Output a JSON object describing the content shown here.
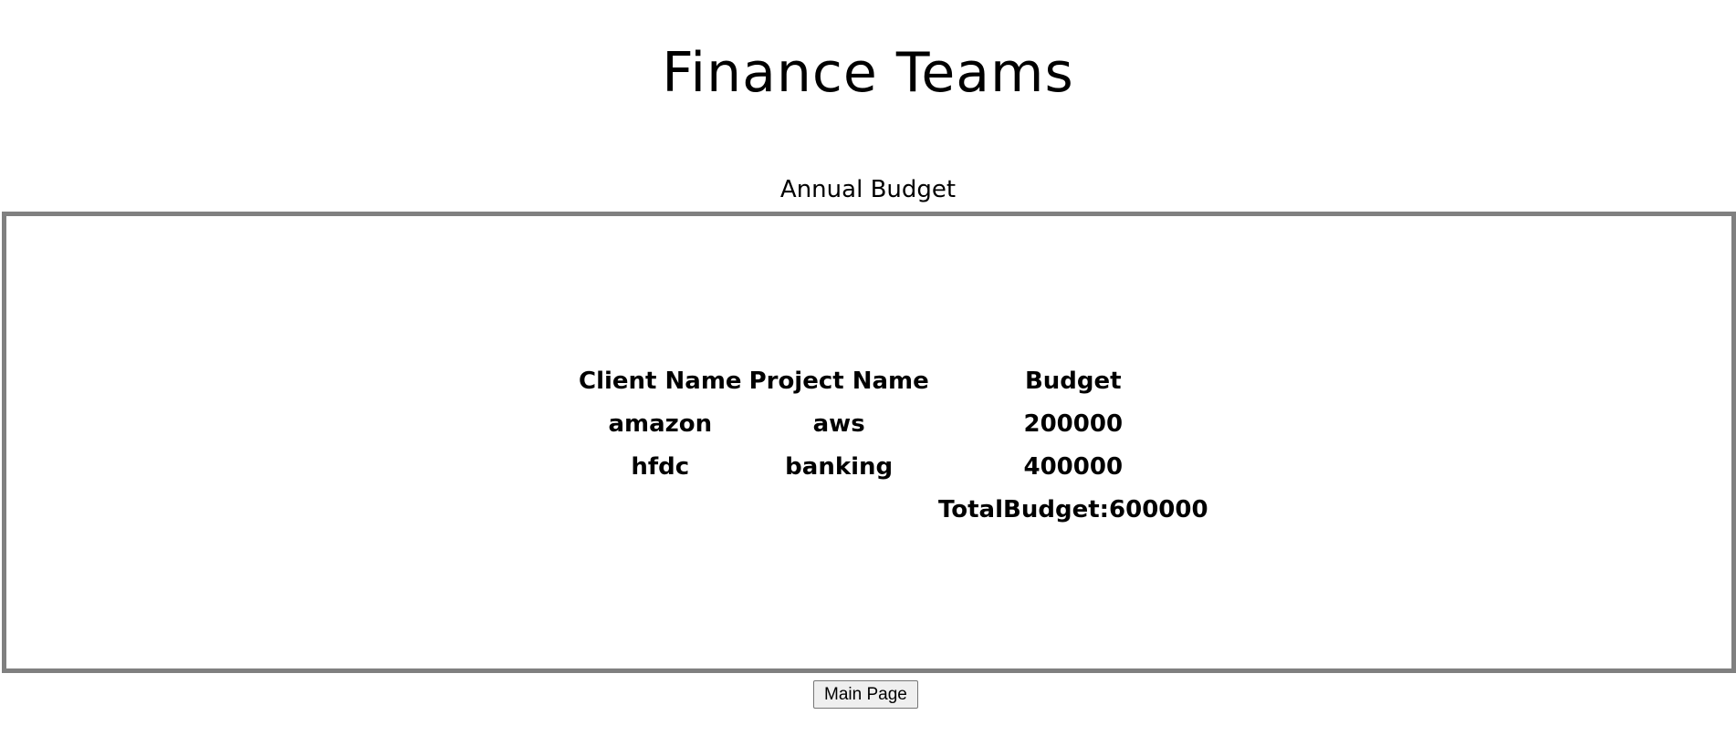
{
  "header": {
    "title": "Finance Teams"
  },
  "section": {
    "title": "Annual Budget"
  },
  "table": {
    "columns": [
      "Client Name",
      "Project Name",
      "Budget"
    ],
    "rows": [
      {
        "client": "amazon",
        "project": "aws",
        "budget": "200000"
      },
      {
        "client": "hfdc",
        "project": "banking",
        "budget": "400000"
      }
    ],
    "total_label": "TotalBudget:600000"
  },
  "footer": {
    "main_page_label": "Main Page"
  },
  "colors": {
    "frame_border": "#808080",
    "button_bg": "#efefef",
    "text": "#000000"
  }
}
